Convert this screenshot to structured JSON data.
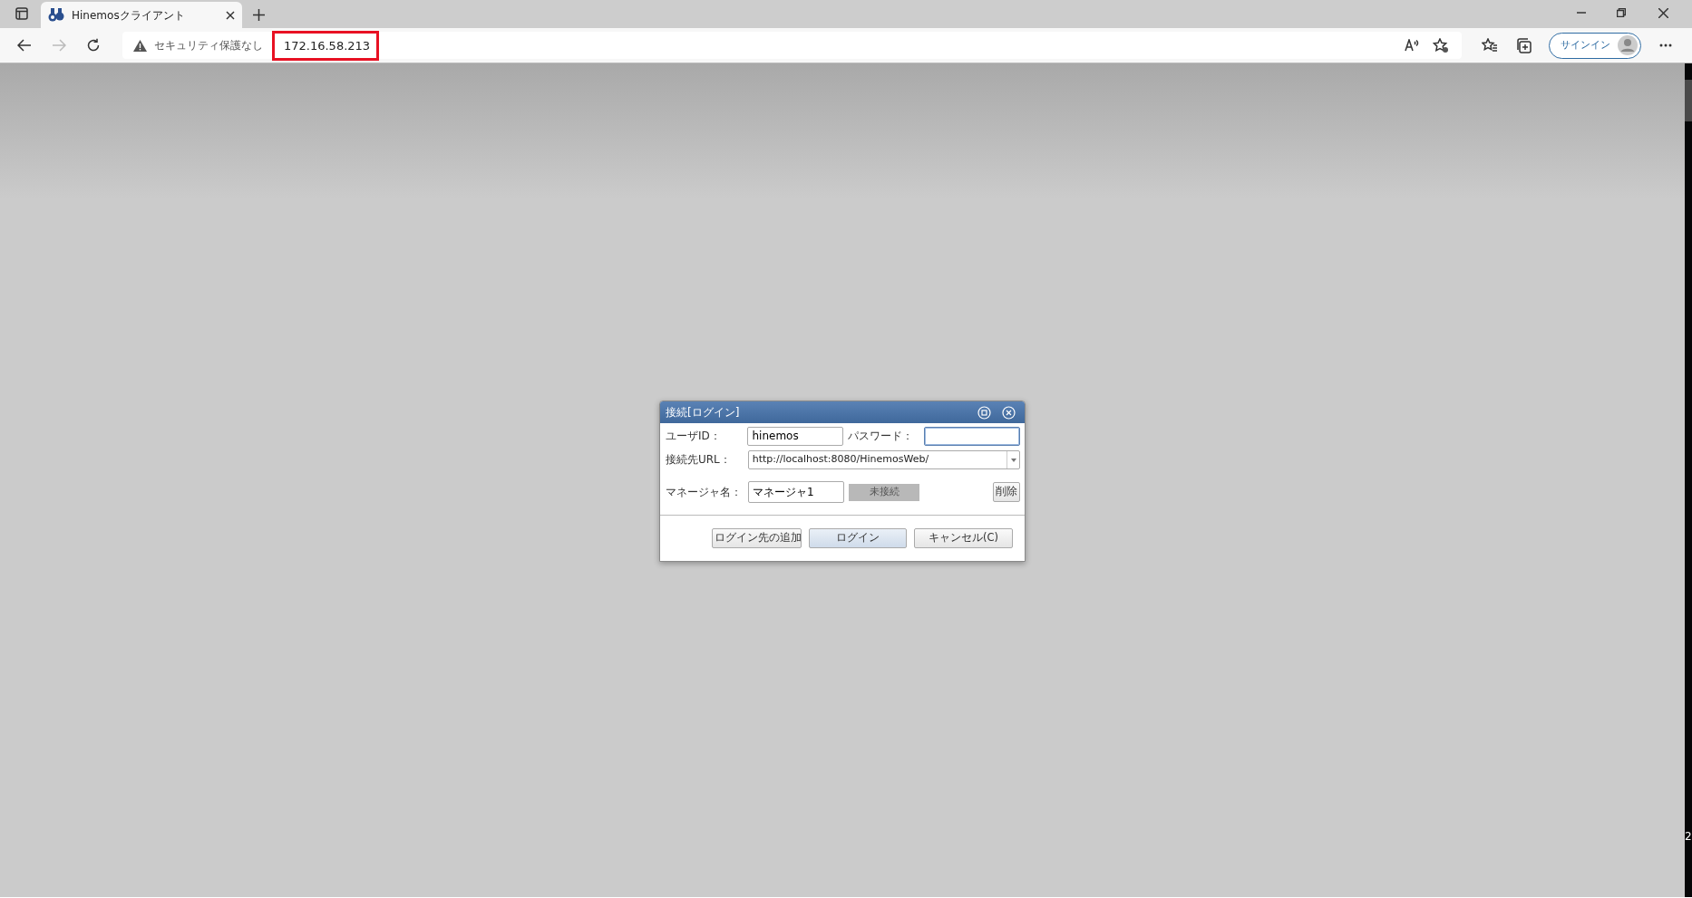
{
  "browser": {
    "tab": {
      "title": "Hinemosクライアント",
      "selected": true
    },
    "security_label": "セキュリティ保護なし",
    "url": "172.16.58.213",
    "sign_in": "サインイン"
  },
  "dialog": {
    "title": "接続[ログイン]",
    "user_id": {
      "label": "ユーザID：",
      "value": "hinemos"
    },
    "password": {
      "label": "パスワード："
    },
    "url": {
      "label": "接続先URL：",
      "value": "http://localhost:8080/HinemosWeb/"
    },
    "manager": {
      "label": "マネージャ名：",
      "value": "マネージャ1",
      "status": "未接続",
      "delete": "削除"
    },
    "buttons": [
      {
        "label": "ログイン先の追加",
        "kind": "normal"
      },
      {
        "label": "ログイン",
        "kind": "default"
      },
      {
        "label": "キャンセル(C)",
        "kind": "normal"
      }
    ]
  },
  "edge_text": "2"
}
